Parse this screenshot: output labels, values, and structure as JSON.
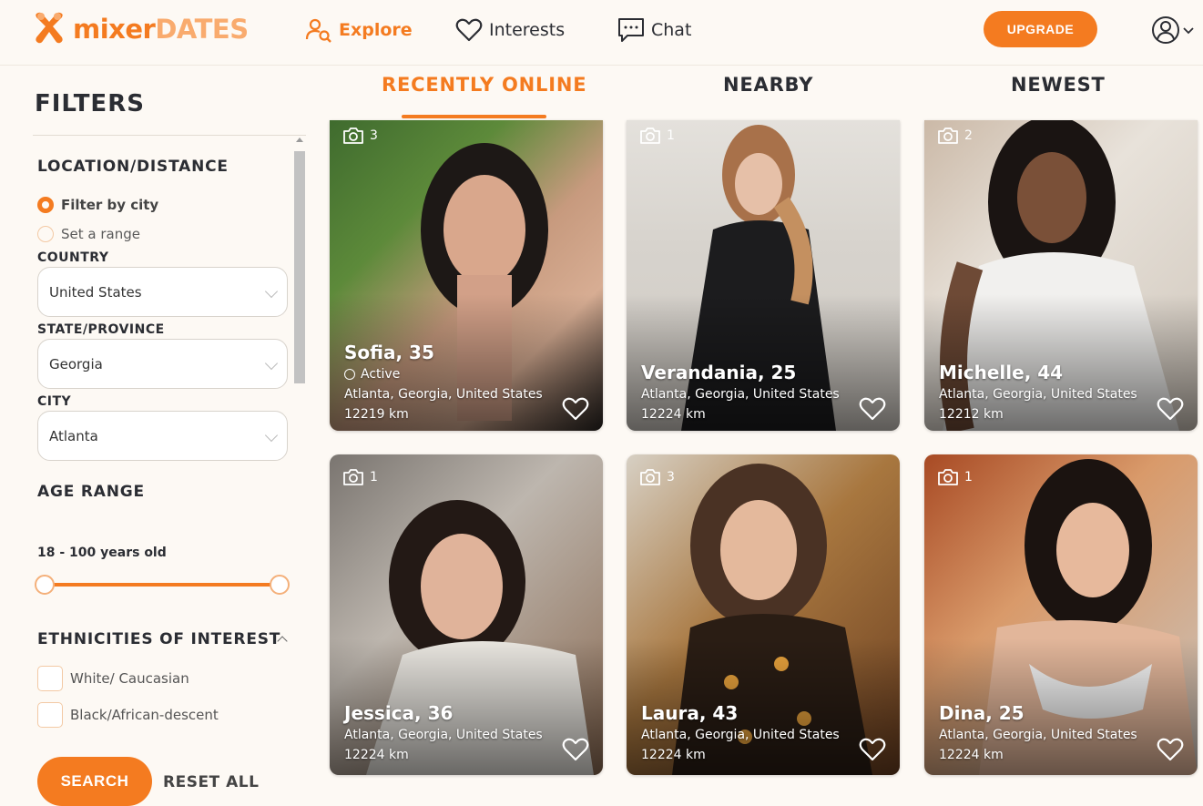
{
  "header": {
    "logo_part1": "mixer",
    "logo_part2": "DATES",
    "nav": [
      {
        "label": "Explore",
        "icon": "explore-icon"
      },
      {
        "label": "Interests",
        "icon": "heart-icon"
      },
      {
        "label": "Chat",
        "icon": "chat-icon"
      }
    ],
    "upgrade_label": "UPGRADE",
    "account_icon": "user-circle-icon"
  },
  "sidebar": {
    "title": "FILTERS",
    "location_title": "LOCATION/DISTANCE",
    "radio_city": "Filter by city",
    "radio_range": "Set a range",
    "country_label": "COUNTRY",
    "country_value": "United States",
    "state_label": "STATE/PROVINCE",
    "state_value": "Georgia",
    "city_label": "CITY",
    "city_value": "Atlanta",
    "age_title": "AGE RANGE",
    "age_value": "18 - 100 years old",
    "age_min": 18,
    "age_max": 100,
    "ethnicities_title": "ETHNICITIES OF INTEREST",
    "ethnicities": [
      "White/ Caucasian",
      "Black/African-descent"
    ],
    "search_label": "SEARCH",
    "reset_label": "RESET ALL"
  },
  "tabs": [
    {
      "label": "RECENTLY ONLINE",
      "active": true
    },
    {
      "label": "NEARBY",
      "active": false
    },
    {
      "label": "NEWEST",
      "active": false
    }
  ],
  "profiles": [
    {
      "name": "Sofia, 35",
      "photos": "3",
      "active": "Active",
      "location": "Atlanta, Georgia, United States",
      "distance": "12219 km"
    },
    {
      "name": "Verandania, 25",
      "photos": "1",
      "active": "",
      "location": "Atlanta, Georgia, United States",
      "distance": "12224 km"
    },
    {
      "name": "Michelle, 44",
      "photos": "2",
      "active": "",
      "location": "Atlanta, Georgia, United States",
      "distance": "12212 km"
    },
    {
      "name": "Jessica, 36",
      "photos": "1",
      "active": "",
      "location": "Atlanta, Georgia, United States",
      "distance": "12224 km"
    },
    {
      "name": "Laura, 43",
      "photos": "3",
      "active": "",
      "location": "Atlanta, Georgia, United States",
      "distance": "12224 km"
    },
    {
      "name": "Dina, 25",
      "photos": "1",
      "active": "",
      "location": "Atlanta, Georgia, United States",
      "distance": "12224 km"
    }
  ],
  "colors": {
    "accent": "#f47b20",
    "background": "#fdf9f4"
  }
}
